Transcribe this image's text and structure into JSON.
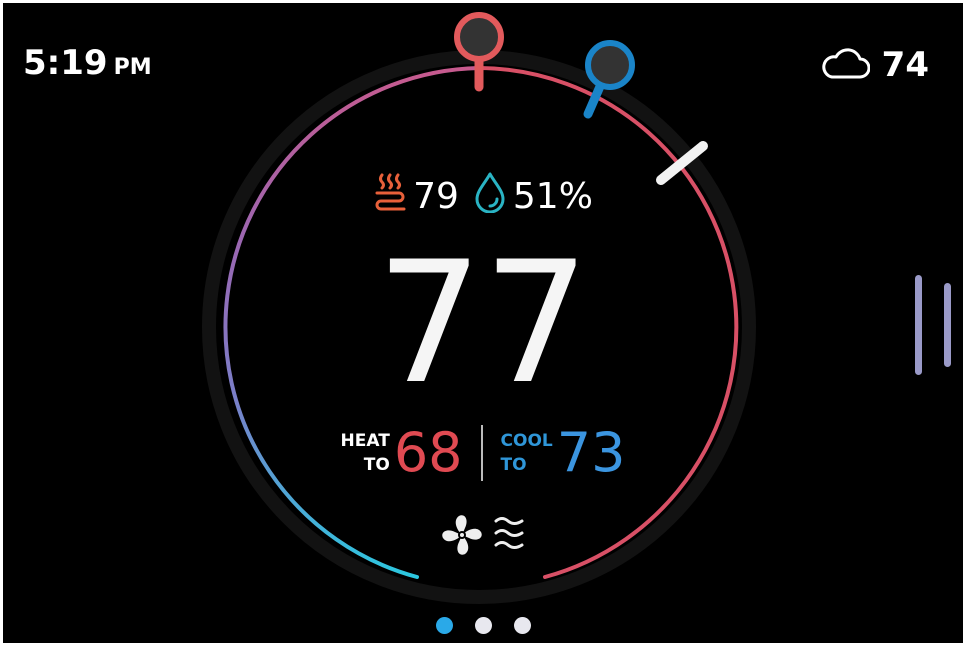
{
  "status_bar": {
    "time": "5:19",
    "ampm": "PM",
    "weather_icon": "cloud-icon",
    "outdoor_temp": "74"
  },
  "indoor": {
    "heat_icon": "heat-waves-icon",
    "temperature": "79",
    "humidity_icon": "water-drop-icon",
    "humidity": "51%"
  },
  "main": {
    "setpoint": "77"
  },
  "setpoints": {
    "heat_label_top": "HEAT",
    "heat_label_bottom": "TO",
    "heat_value": "68",
    "cool_label_top": "COOL",
    "cool_label_bottom": "TO",
    "cool_value": "73"
  },
  "mode_icons": [
    "fan-icon",
    "air-flow-icon"
  ],
  "pager": {
    "pages": 3,
    "active": 1
  },
  "colors": {
    "heat": "#e04a52",
    "cool": "#3b95e0",
    "arc_warm": "#d85066",
    "arc_purple": "#9a67b2",
    "arc_cyan": "#2cc7df",
    "heat_marker": "#e25a5c",
    "cool_marker": "#1a84c8",
    "heat_icon": "#e8603a",
    "humidity_icon": "#2ab4c4"
  }
}
